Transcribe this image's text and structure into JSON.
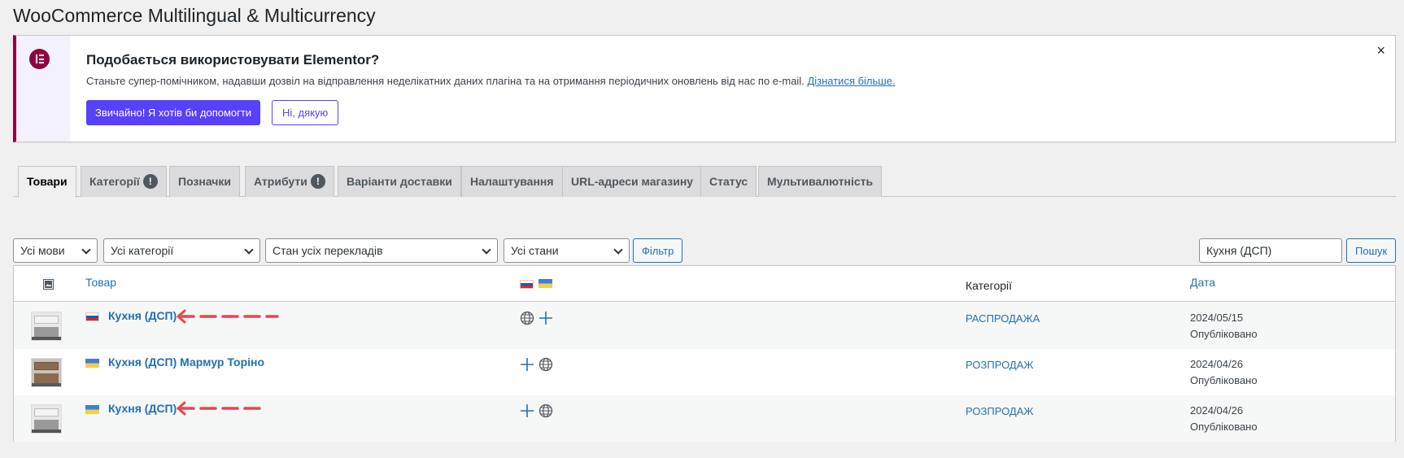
{
  "page": {
    "title": "WooCommerce Multilingual & Multicurrency"
  },
  "notice": {
    "title": "Подобається використовувати Elementor?",
    "text": "Станьте супер-помічником, надавши дозвіл на відправлення неделікатних даних плагіна та на отримання періодичних оновлень від нас по e-mail.",
    "link_label": "Дізнатися більше.",
    "primary_button": "Звичайно! Я хотів би допомогти",
    "secondary_button": "Ні, дякую",
    "close_icon": "×",
    "logo_icon": "elementor-logo-icon",
    "accent_color": "#93003f",
    "button_color": "#5741fb"
  },
  "tabs": [
    {
      "label": "Товари",
      "active": true
    },
    {
      "label": "Категорії",
      "badge": "!"
    },
    {
      "label": "Позначки"
    },
    {
      "label": "Атрибути",
      "badge": "!"
    },
    {
      "label": "Варіанти доставки"
    },
    {
      "label": "Налаштування"
    },
    {
      "label": "URL-адреси магазину"
    },
    {
      "label": "Статус"
    },
    {
      "label": "Мультивалютність"
    }
  ],
  "filters": {
    "language": "Усі мови",
    "category": "Усі категорії",
    "translation_status": "Стан усіх перекладів",
    "status": "Усі стани",
    "filter_button": "Фільтр",
    "search_value": "Кухня (ДСП)",
    "search_button": "Пошук"
  },
  "table": {
    "columns": {
      "thumbnail_icon": "image-icon",
      "product": "Товар",
      "languages": [
        "ru",
        "ua"
      ],
      "categories": "Категорії",
      "date": "Дата"
    },
    "rows": [
      {
        "flag": "ru",
        "name": "Кухня (ДСП)",
        "actions": [
          "globe-icon",
          "plus-icon"
        ],
        "category": "РАСПРОДАЖА",
        "date": "2024/05/15",
        "status": "Опубліковано",
        "annotated": true
      },
      {
        "flag": "ua",
        "name": "Кухня (ДСП) Мармур Торіно",
        "actions": [
          "plus-icon",
          "globe-icon"
        ],
        "category": "РОЗПРОДАЖ",
        "date": "2024/04/26",
        "status": "Опубліковано",
        "annotated": false
      },
      {
        "flag": "ua",
        "name": "Кухня (ДСП)",
        "actions": [
          "plus-icon",
          "globe-icon"
        ],
        "category": "РОЗПРОДАЖ",
        "date": "2024/04/26",
        "status": "Опубліковано",
        "annotated": true
      }
    ]
  },
  "colors": {
    "link": "#2271b1",
    "annotation_arrow": "#e5484d"
  }
}
